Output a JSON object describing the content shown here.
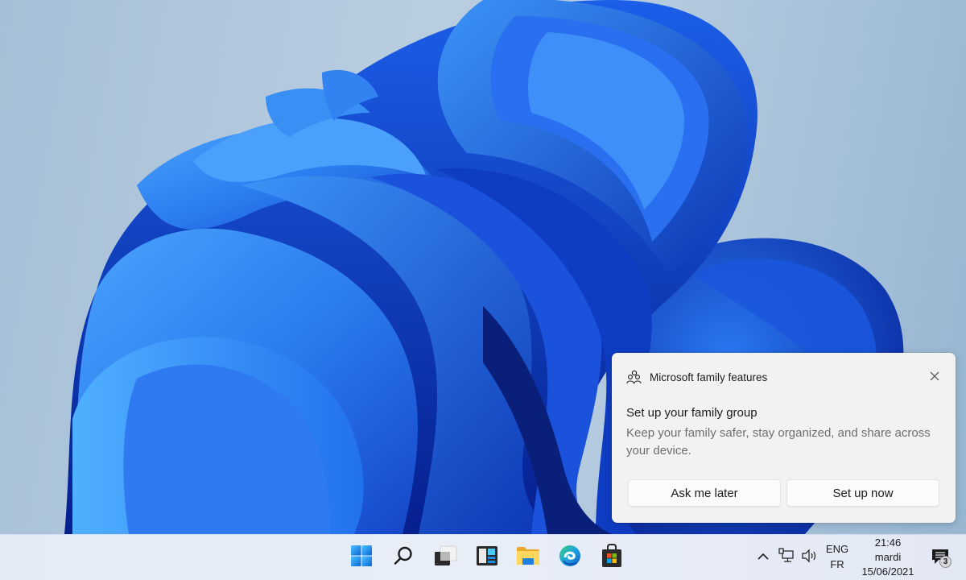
{
  "desktop": {
    "wallpaper": "Windows 11 bloom (blue)",
    "colors": {
      "background": "#b4c9dd",
      "bloom_light": "#3b8ef5",
      "bloom_mid": "#1f5fe6",
      "bloom_dark": "#0a2ba8"
    }
  },
  "notification": {
    "app_icon": "family-icon",
    "app_name": "Microsoft family features",
    "close_icon": "close-icon",
    "title": "Set up your family group",
    "body": "Keep your family safer, stay organized, and share across your device.",
    "buttons": [
      {
        "label": "Ask me later"
      },
      {
        "label": "Set up now"
      }
    ]
  },
  "taskbar": {
    "apps": [
      {
        "name": "Start",
        "icon": "windows-start-icon"
      },
      {
        "name": "Search",
        "icon": "search-icon"
      },
      {
        "name": "Task View",
        "icon": "task-view-icon"
      },
      {
        "name": "Widgets",
        "icon": "widgets-icon"
      },
      {
        "name": "File Explorer",
        "icon": "folder-icon"
      },
      {
        "name": "Microsoft Edge",
        "icon": "edge-icon"
      },
      {
        "name": "Microsoft Store",
        "icon": "store-icon"
      }
    ],
    "tray": {
      "overflow_icon": "chevron-up-icon",
      "network_icon": "network-wired-icon",
      "volume_icon": "volume-icon",
      "language": {
        "line1": "ENG",
        "line2": "FR"
      },
      "clock": {
        "time": "21:46",
        "day": "mardi",
        "date": "15/06/2021"
      },
      "notifications": {
        "icon": "action-center-icon",
        "count": "3"
      }
    },
    "colors": {
      "accent": "#0078d4"
    }
  }
}
